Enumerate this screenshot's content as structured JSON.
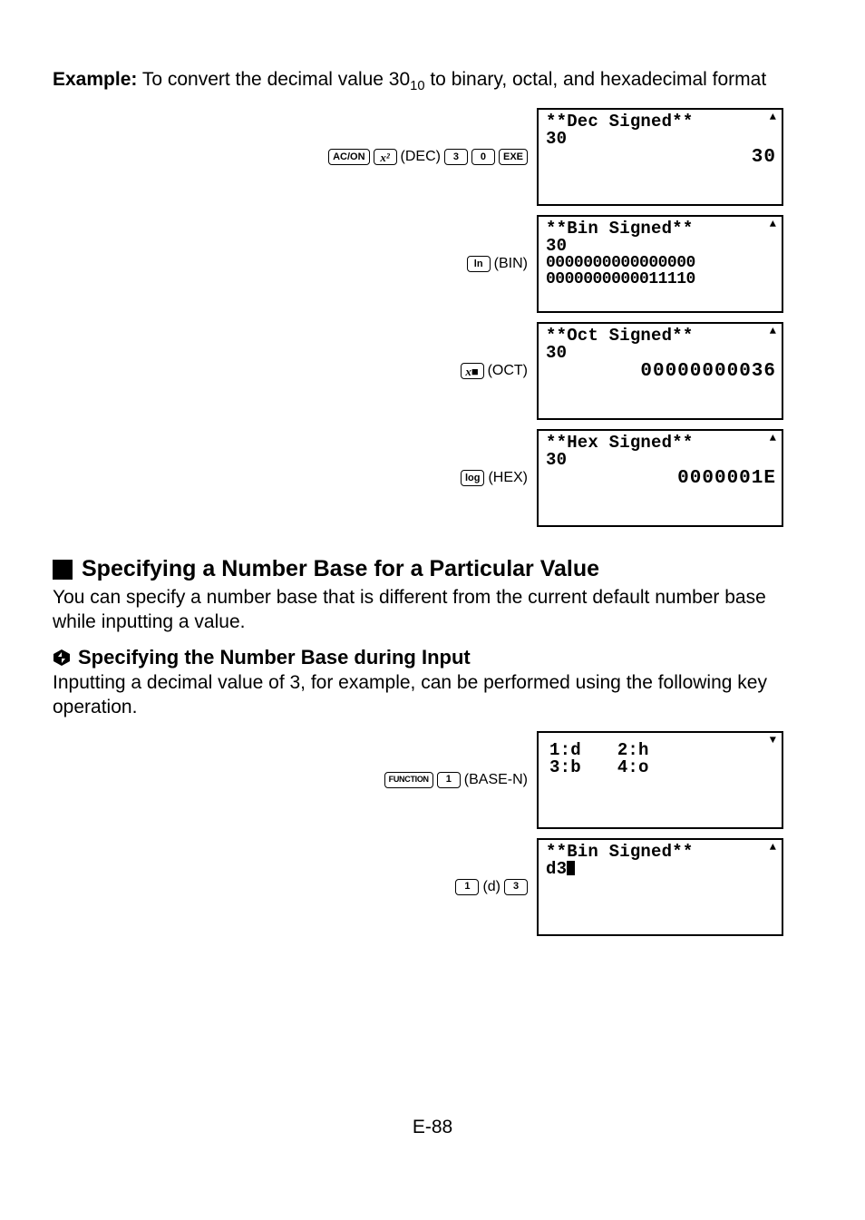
{
  "example": {
    "label": "Example:",
    "text_before_sub": " To convert the decimal value 30",
    "sub": "10",
    "text_after_sub": " to binary, octal, and hexadecimal format"
  },
  "rows": [
    {
      "keys": [
        {
          "type": "key",
          "cls": "",
          "txt": "AC/ON"
        },
        {
          "type": "key",
          "cls": "italic",
          "txt": "x²"
        },
        {
          "type": "paren",
          "txt": "(DEC)"
        },
        {
          "type": "key",
          "cls": "",
          "txt": "3"
        },
        {
          "type": "key",
          "cls": "",
          "txt": "0"
        },
        {
          "type": "key",
          "cls": "",
          "txt": "EXE"
        }
      ],
      "lcd": {
        "arrow": "up",
        "lines": [
          {
            "cls": "l",
            "txt": "**Dec Signed**"
          },
          {
            "cls": "l",
            "txt": "30"
          },
          {
            "cls": "r",
            "txt": "30"
          }
        ]
      }
    },
    {
      "keys": [
        {
          "type": "key",
          "cls": "",
          "txt": "ln"
        },
        {
          "type": "paren",
          "txt": "(BIN)"
        }
      ],
      "lcd": {
        "arrow": "up",
        "lines": [
          {
            "cls": "l",
            "txt": "**Bin Signed**"
          },
          {
            "cls": "l",
            "txt": "30"
          },
          {
            "cls": "l tight",
            "txt": "0000000000000000"
          },
          {
            "cls": "l tight",
            "txt": "0000000000011110"
          }
        ]
      }
    },
    {
      "keys": [
        {
          "type": "key",
          "cls": "italic",
          "txt": "x■"
        },
        {
          "type": "paren",
          "txt": "(OCT)"
        }
      ],
      "lcd": {
        "arrow": "up",
        "lines": [
          {
            "cls": "l",
            "txt": "**Oct Signed**"
          },
          {
            "cls": "l",
            "txt": "30"
          },
          {
            "cls": "r",
            "txt": "00000000036"
          }
        ]
      }
    },
    {
      "keys": [
        {
          "type": "key",
          "cls": "",
          "txt": "log"
        },
        {
          "type": "paren",
          "txt": "(HEX)"
        }
      ],
      "lcd": {
        "arrow": "up",
        "lines": [
          {
            "cls": "l",
            "txt": "**Hex Signed**"
          },
          {
            "cls": "l",
            "txt": "30"
          },
          {
            "cls": "r",
            "txt": "0000001E"
          }
        ]
      }
    }
  ],
  "section1": {
    "title": "Specifying a Number Base for a Particular Value",
    "para": "You can specify a number base that is different from the current default number base while inputting a value."
  },
  "section2": {
    "title": "Specifying the Number Base during Input",
    "para": "Inputting a decimal value of 3, for example, can be performed using the following key operation."
  },
  "rows2": [
    {
      "keys": [
        {
          "type": "key",
          "cls": "wide",
          "txt": "FUNCTION"
        },
        {
          "type": "key",
          "cls": "",
          "txt": "1"
        },
        {
          "type": "paren",
          "txt": "(BASE-N)"
        }
      ],
      "lcd": {
        "arrow": "down",
        "menu": [
          [
            "1:d",
            "3:b"
          ],
          [
            "2:h",
            "4:o"
          ]
        ]
      }
    },
    {
      "keys": [
        {
          "type": "key",
          "cls": "",
          "txt": "1"
        },
        {
          "type": "paren",
          "txt": "(d)"
        },
        {
          "type": "key",
          "cls": "",
          "txt": "3"
        }
      ],
      "lcd": {
        "arrow": "up",
        "lines": [
          {
            "cls": "l",
            "txt": "**Bin Signed**"
          },
          {
            "cls": "l",
            "txt": "d3",
            "cursor": true
          }
        ]
      }
    }
  ],
  "pagenum": "E-88"
}
